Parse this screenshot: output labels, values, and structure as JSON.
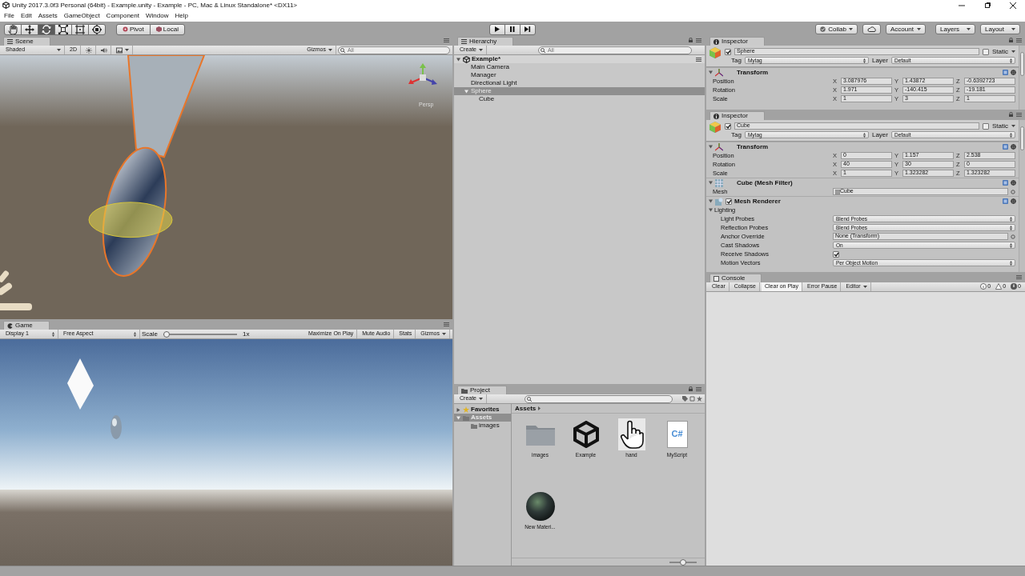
{
  "window": {
    "title": "Unity 2017.3.0f3 Personal (64bit) - Example.unity - Example - PC, Mac & Linux Standalone* <DX11>"
  },
  "menu": [
    "File",
    "Edit",
    "Assets",
    "GameObject",
    "Component",
    "Window",
    "Help"
  ],
  "toolbar": {
    "tools": [
      {
        "kind": "hand",
        "selected": false
      },
      {
        "kind": "move",
        "selected": false
      },
      {
        "kind": "rotate",
        "selected": true
      },
      {
        "kind": "scale",
        "selected": false
      },
      {
        "kind": "rect",
        "selected": false
      },
      {
        "kind": "transform",
        "selected": false
      }
    ],
    "handle_buttons": [
      {
        "kind": "pivot",
        "label": "Pivot"
      },
      {
        "kind": "local",
        "label": "Local"
      }
    ],
    "account_buttons": [
      {
        "kind": "collab",
        "label": "Collab"
      },
      {
        "kind": "cloud"
      },
      {
        "kind": "menu",
        "label": "Account"
      },
      {
        "kind": "menu",
        "label": "Layers"
      },
      {
        "kind": "menu",
        "label": "Layout"
      }
    ]
  },
  "scene": {
    "tab": "Scene",
    "shading": "Shaded",
    "mode_2d": "2D",
    "gizmos": "Gizmos",
    "search_placeholder": "All",
    "view_label": "Persp"
  },
  "game": {
    "tab": "Game",
    "display": "Display 1",
    "aspect": "Free Aspect",
    "scale_label": "Scale",
    "scale": {
      "level": 0.0
    },
    "scale_value": "1x",
    "buttons": [
      {
        "kind": "toggle",
        "label": "Maximize On Play"
      },
      {
        "kind": "toggle",
        "label": "Mute Audio"
      },
      {
        "kind": "toggle",
        "label": "Stats"
      },
      {
        "kind": "dropdown",
        "label": "Gizmos"
      }
    ]
  },
  "hierarchy": {
    "tab": "Hierarchy",
    "create": "Create",
    "search_placeholder": "All",
    "tree": [
      {
        "kind": "scene",
        "label": "Example*",
        "expanded": true,
        "selected": false,
        "children": [
          {
            "label": "Main Camera",
            "selected": false
          },
          {
            "label": "Manager",
            "selected": false
          },
          {
            "label": "Directional Light",
            "selected": false
          },
          {
            "label": "Sphere",
            "selected": true,
            "expanded": true,
            "children": [
              {
                "label": "Cube",
                "selected": false
              }
            ]
          }
        ]
      }
    ]
  },
  "project": {
    "tab": "Project",
    "create": "Create",
    "tree": [
      {
        "kind": "favorites",
        "label": "Favorites",
        "expanded": false,
        "selected": false
      },
      {
        "kind": "folder",
        "label": "Assets",
        "expanded": true,
        "selected": true,
        "children": [
          {
            "kind": "folder",
            "label": "images",
            "selected": false
          }
        ]
      }
    ],
    "breadcrumb": "Assets",
    "assets": [
      {
        "kind": "folder",
        "label": "images"
      },
      {
        "kind": "unity",
        "label": "Example"
      },
      {
        "kind": "hand",
        "label": "hand"
      },
      {
        "kind": "script",
        "label": "MyScript",
        "glyph": "C#"
      },
      {
        "kind": "material",
        "label": "New Materi..."
      }
    ],
    "icon_size": {
      "level": 0.5
    }
  },
  "inspectors": [
    {
      "tab": "Inspector",
      "object": {
        "name": "Sphere",
        "active": true,
        "static_label": "Static",
        "static": false,
        "tag_label": "Tag",
        "tag": "Mytag",
        "layer_label": "Layer",
        "layer": "Default"
      },
      "components": [
        {
          "kind": "transform",
          "title": "Transform",
          "expanded": true,
          "rows": [
            {
              "kind": "vector3",
              "label": "Position",
              "fields": [
                {
                  "axis": "X",
                  "value": "3.087976"
                },
                {
                  "axis": "Y",
                  "value": "1.43872"
                },
                {
                  "axis": "Z",
                  "value": "-0.6392723"
                }
              ]
            },
            {
              "kind": "vector3",
              "label": "Rotation",
              "fields": [
                {
                  "axis": "X",
                  "value": "1.971"
                },
                {
                  "axis": "Y",
                  "value": "-140.415"
                },
                {
                  "axis": "Z",
                  "value": "-19.181"
                }
              ]
            },
            {
              "kind": "vector3",
              "label": "Scale",
              "fields": [
                {
                  "axis": "X",
                  "value": "1"
                },
                {
                  "axis": "Y",
                  "value": "3"
                },
                {
                  "axis": "Z",
                  "value": "1"
                }
              ]
            }
          ]
        }
      ]
    },
    {
      "tab": "Inspector",
      "object": {
        "name": "Cube",
        "active": true,
        "static_label": "Static",
        "static": false,
        "tag_label": "Tag",
        "tag": "Mytag",
        "layer_label": "Layer",
        "layer": "Default"
      },
      "components": [
        {
          "kind": "transform",
          "title": "Transform",
          "expanded": true,
          "rows": [
            {
              "kind": "vector3",
              "label": "Position",
              "fields": [
                {
                  "axis": "X",
                  "value": "0"
                },
                {
                  "axis": "Y",
                  "value": "1.157"
                },
                {
                  "axis": "Z",
                  "value": "2.538"
                }
              ]
            },
            {
              "kind": "vector3",
              "label": "Rotation",
              "fields": [
                {
                  "axis": "X",
                  "value": "40"
                },
                {
                  "axis": "Y",
                  "value": "30"
                },
                {
                  "axis": "Z",
                  "value": "0"
                }
              ]
            },
            {
              "kind": "vector3",
              "label": "Scale",
              "fields": [
                {
                  "axis": "X",
                  "value": "1"
                },
                {
                  "axis": "Y",
                  "value": "1.323282"
                },
                {
                  "axis": "Z",
                  "value": "1.323282"
                }
              ]
            }
          ]
        },
        {
          "kind": "mesh_filter",
          "title": "Cube (Mesh Filter)",
          "expanded": true,
          "rows": [
            {
              "kind": "object",
              "label": "Mesh",
              "value": "Cube",
              "has_icon": true
            }
          ]
        },
        {
          "kind": "mesh_renderer",
          "title": "Mesh Renderer",
          "enabled": true,
          "expanded": true,
          "groups": [
            {
              "label": "Lighting",
              "expanded": true,
              "rows": [
                {
                  "kind": "dropdown",
                  "label": "Light Probes",
                  "value": "Blend Probes"
                },
                {
                  "kind": "dropdown",
                  "label": "Reflection Probes",
                  "value": "Blend Probes"
                },
                {
                  "kind": "object",
                  "label": "Anchor Override",
                  "value": "None (Transform)",
                  "has_icon": false
                },
                {
                  "kind": "dropdown",
                  "label": "Cast Shadows",
                  "value": "On"
                },
                {
                  "kind": "toggle",
                  "label": "Receive Shadows",
                  "checked": true
                },
                {
                  "kind": "dropdown",
                  "label": "Motion Vectors",
                  "value": "Per Object Motion"
                }
              ]
            }
          ]
        }
      ]
    }
  ],
  "console": {
    "tab": "Console",
    "buttons": [
      {
        "kind": "button",
        "label": "Clear",
        "on": false
      },
      {
        "kind": "toggle",
        "label": "Collapse",
        "on": false
      },
      {
        "kind": "toggle",
        "label": "Clear on Play",
        "on": true
      },
      {
        "kind": "toggle",
        "label": "Error Pause",
        "on": false
      },
      {
        "kind": "dropdown",
        "label": "Editor",
        "on": false
      }
    ],
    "counts": [
      {
        "kind": "info",
        "value": "0"
      },
      {
        "kind": "warning",
        "value": "0"
      },
      {
        "kind": "error",
        "value": "0"
      }
    ]
  }
}
